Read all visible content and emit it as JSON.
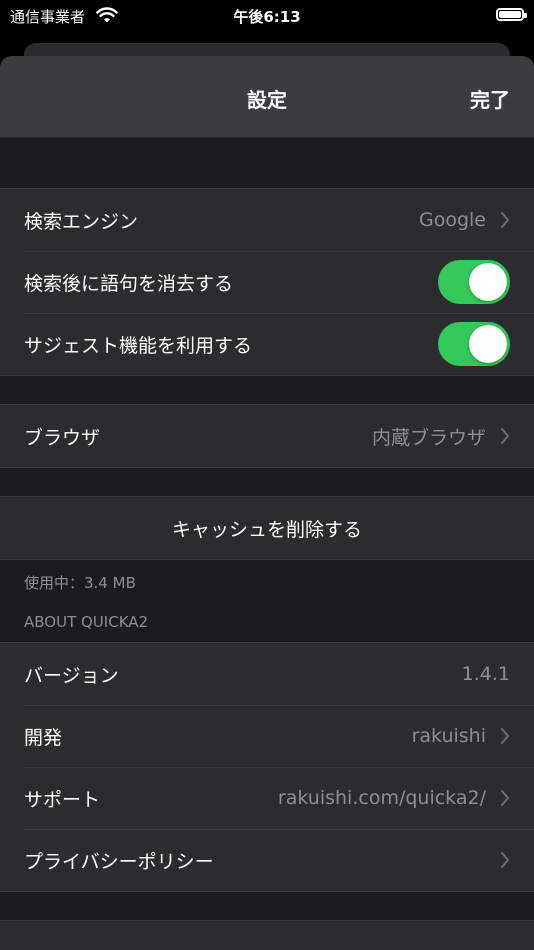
{
  "status_bar": {
    "carrier": "通信事業者",
    "time": "午後6:13",
    "icons": [
      "wifi-icon",
      "battery-icon"
    ]
  },
  "nav": {
    "title": "設定",
    "done": "完了"
  },
  "search_group": {
    "engine_label": "検索エンジン",
    "engine_value": "Google",
    "clear_label": "検索後に語句を消去する",
    "clear_on": true,
    "suggest_label": "サジェスト機能を利用する",
    "suggest_on": true
  },
  "browser_group": {
    "label": "ブラウザ",
    "value": "内蔵ブラウザ"
  },
  "cache": {
    "button": "キャッシュを削除する",
    "usage": "使用中：3.4 MB"
  },
  "about": {
    "header": "ABOUT QUICKA2",
    "version_label": "バージョン",
    "version_value": "1.4.1",
    "developer_label": "開発",
    "developer_value": "rakuishi",
    "support_label": "サポート",
    "support_value": "rakuishi.com/quicka2/",
    "privacy_label": "プライバシーポリシー"
  },
  "colors": {
    "toggle_on": "#34c759",
    "nav_bg": "#3a3c41",
    "cell_bg": "#2c2c2e",
    "secondary_text": "#8e8e93"
  }
}
